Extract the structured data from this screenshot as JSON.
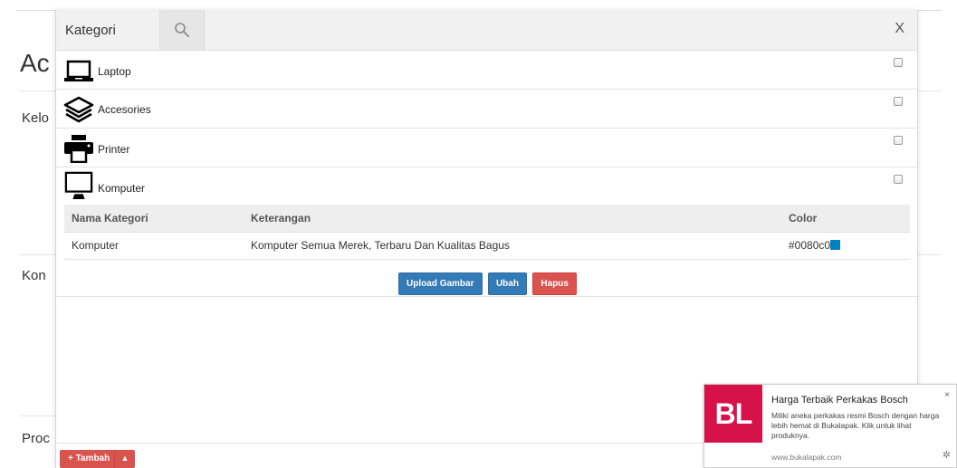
{
  "background": {
    "title": "Ac",
    "labels": [
      "Kelo",
      "Kon",
      "Proc"
    ]
  },
  "modal": {
    "title": "Kategori",
    "close_label": "X",
    "categories": [
      {
        "label": "Laptop",
        "icon": "laptop-icon"
      },
      {
        "label": "Accesories",
        "icon": "layers-icon"
      },
      {
        "label": "Printer",
        "icon": "printer-icon"
      },
      {
        "label": "Komputer",
        "icon": "desktop-monitor-icon"
      }
    ],
    "detail": {
      "headers": [
        "Nama Kategori",
        "Keterangan",
        "Color"
      ],
      "row": {
        "name": "Komputer",
        "description": "Komputer Semua Merek, Terbaru Dan Kualitas Bagus",
        "color": "#0080c0"
      }
    },
    "actions": {
      "upload": "Upload Gambar",
      "edit": "Ubah",
      "delete": "Hapus"
    }
  },
  "footer": {
    "add_label": "+ Tambah",
    "caret": "▲"
  },
  "notification": {
    "logo": "BL",
    "title": "Harga Terbaik Perkakas Bosch",
    "body": "Miliki aneka perkakas resmi Bosch dengan harga lebih hemat di Bukalapak. Klik untuk lihat produknya.",
    "url": "www.bukalapak.com",
    "close": "×",
    "gear": "✲"
  },
  "colors": {
    "primary_button": "#337ab7",
    "danger_button": "#d9534f",
    "brand_bukalapak": "#d71149",
    "category_color": "#0080c0"
  }
}
